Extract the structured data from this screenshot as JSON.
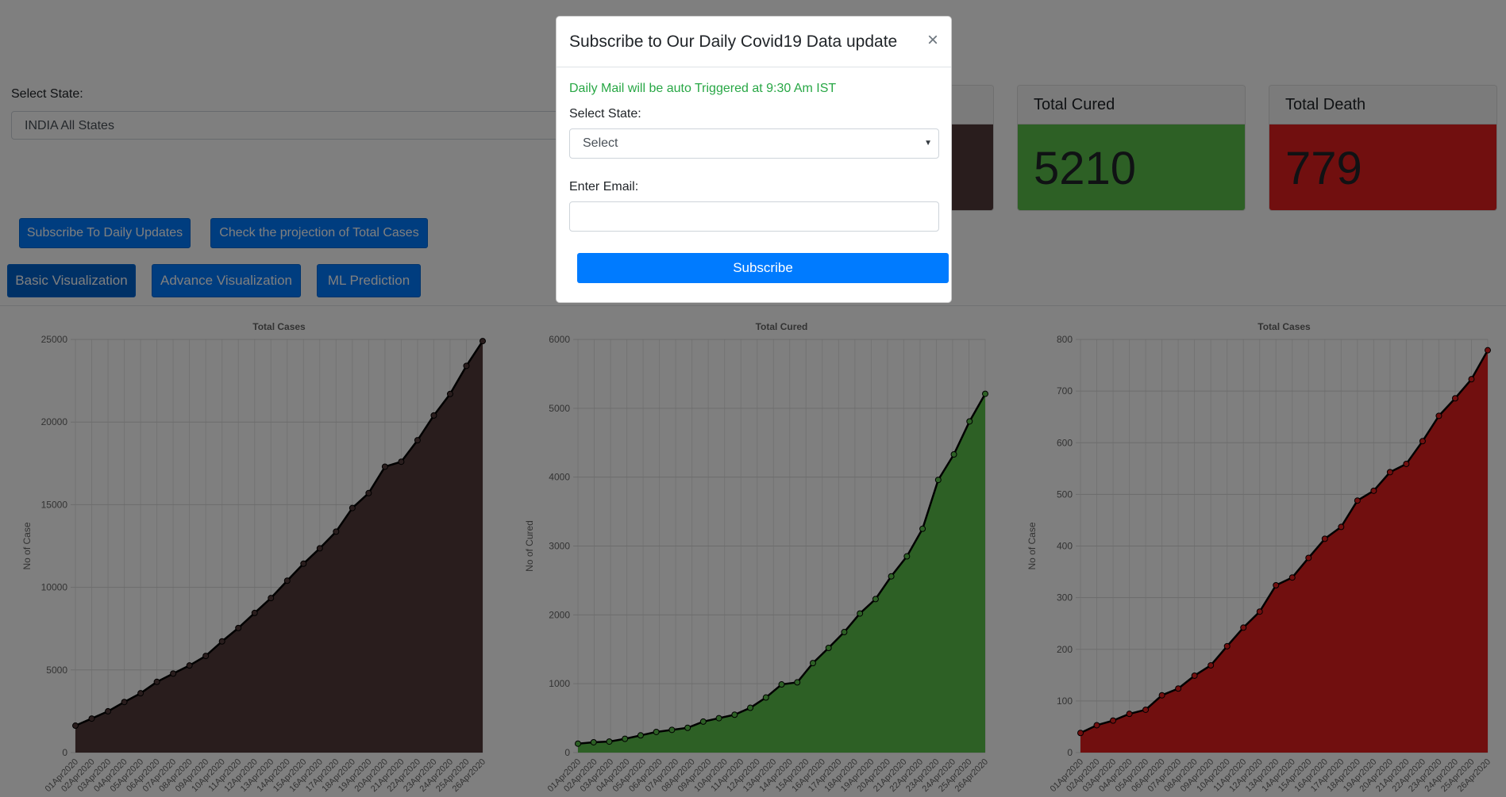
{
  "main": {
    "state_label": "Select State:",
    "state_value": "INDIA All States",
    "buttons": {
      "subscribe_daily": "Subscribe To Daily Updates",
      "projection": "Check the projection of Total Cases",
      "basic": "Basic Visualization",
      "advance": "Advance Visualization",
      "ml": "ML Prediction"
    }
  },
  "cards": {
    "confirmed": {
      "title": "",
      "value": ""
    },
    "cured": {
      "title": "Total Cured",
      "value": "5210"
    },
    "death": {
      "title": "Total Death",
      "value": "779"
    }
  },
  "modal": {
    "title": "Subscribe to Our Daily Covid19 Data update",
    "close": "×",
    "notice": "Daily Mail will be auto Triggered at 9:30 Am IST",
    "state_label": "Select State:",
    "state_value": "Select",
    "email_label": "Enter Email:",
    "email_value": "",
    "email_placeholder": "",
    "submit_label": "Subscribe"
  },
  "colors": {
    "primary": "#007bff",
    "success_text": "#28a745",
    "confirmed": "#533a3a",
    "cured": "#5bc14a",
    "death": "#e31e1e"
  },
  "chart_data": [
    {
      "type": "area",
      "title": "Total Cases",
      "xlabel": "",
      "ylabel": "No of Case",
      "ylim": [
        0,
        25000
      ],
      "yticks": [
        0,
        5000,
        10000,
        15000,
        20000,
        25000
      ],
      "grid": true,
      "fill": "#533a3a",
      "x": [
        "01Apr2020",
        "02Apr2020",
        "03Apr2020",
        "04Apr2020",
        "05Apr2020",
        "06Apr2020",
        "07Apr2020",
        "08Apr2020",
        "09Apr2020",
        "10Apr2020",
        "11Apr2020",
        "12Apr2020",
        "13Apr2020",
        "14Apr2020",
        "15Apr2020",
        "16Apr2020",
        "17Apr2020",
        "18Apr2020",
        "19Apr2020",
        "20Apr2020",
        "21Apr2020",
        "22Apr2020",
        "23Apr2020",
        "24Apr2020",
        "25Apr2020",
        "26Apr2020"
      ],
      "values": [
        1630,
        2060,
        2500,
        3060,
        3590,
        4280,
        4780,
        5270,
        5850,
        6730,
        7540,
        8450,
        9350,
        10400,
        11430,
        12360,
        13370,
        14800,
        15700,
        17300,
        17600,
        18900,
        20400,
        21700,
        23400,
        24900
      ]
    },
    {
      "type": "area",
      "title": "Total Cured",
      "xlabel": "",
      "ylabel": "No of Cured",
      "ylim": [
        0,
        6000
      ],
      "yticks": [
        0,
        1000,
        2000,
        3000,
        4000,
        5000,
        6000
      ],
      "grid": true,
      "fill": "#5bc14a",
      "x": [
        "01Apr2020",
        "02Apr2020",
        "03Apr2020",
        "04Apr2020",
        "05Apr2020",
        "06Apr2020",
        "07Apr2020",
        "08Apr2020",
        "09Apr2020",
        "10Apr2020",
        "11Apr2020",
        "12Apr2020",
        "13Apr2020",
        "14Apr2020",
        "15Apr2020",
        "16Apr2020",
        "17Apr2020",
        "18Apr2020",
        "19Apr2020",
        "20Apr2020",
        "21Apr2020",
        "22Apr2020",
        "23Apr2020",
        "24Apr2020",
        "25Apr2020",
        "26Apr2020"
      ],
      "values": [
        130,
        150,
        160,
        200,
        250,
        300,
        330,
        360,
        450,
        500,
        550,
        650,
        800,
        990,
        1020,
        1300,
        1520,
        1750,
        2020,
        2230,
        2560,
        2850,
        3250,
        3960,
        4330,
        4810,
        5210
      ]
    },
    {
      "type": "area",
      "title": "Total Cases",
      "xlabel": "",
      "ylabel": "No of Case",
      "ylim": [
        0,
        800
      ],
      "yticks": [
        0,
        100,
        200,
        300,
        400,
        500,
        600,
        700,
        800
      ],
      "grid": true,
      "fill": "#e31e1e",
      "x": [
        "01Apr2020",
        "02Apr2020",
        "03Apr2020",
        "04Apr2020",
        "05Apr2020",
        "06Apr2020",
        "07Apr2020",
        "08Apr2020",
        "09Apr2020",
        "10Apr2020",
        "11Apr2020",
        "12Apr2020",
        "13Apr2020",
        "14Apr2020",
        "15Apr2020",
        "16Apr2020",
        "17Apr2020",
        "18Apr2020",
        "19Apr2020",
        "20Apr2020",
        "21Apr2020",
        "22Apr2020",
        "23Apr2020",
        "24Apr2020",
        "25Apr2020",
        "26Apr2020"
      ],
      "values": [
        38,
        53,
        62,
        75,
        83,
        111,
        124,
        149,
        169,
        206,
        242,
        273,
        324,
        339,
        377,
        414,
        437,
        488,
        507,
        543,
        559,
        603,
        652,
        686,
        723,
        779
      ]
    }
  ]
}
